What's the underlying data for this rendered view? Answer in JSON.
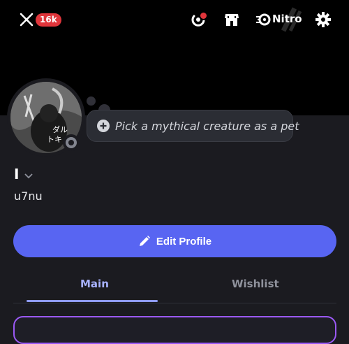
{
  "header": {
    "badge_count": "16k",
    "nitro_label": "Nitro",
    "colors": {
      "badge": "#e0353b",
      "accent": "#5865f2"
    }
  },
  "profile": {
    "status_text": "Pick a mythical creature as a pet",
    "display_name": "I",
    "username": "u7nu",
    "avatar_text": "ダルトキッド"
  },
  "actions": {
    "edit_profile_label": "Edit Profile"
  },
  "tabs": [
    {
      "label": "Main",
      "active": true
    },
    {
      "label": "Wishlist",
      "active": false
    }
  ],
  "icons": [
    "close-icon",
    "quests-icon",
    "shop-icon",
    "nitro-icon",
    "settings-icon",
    "plus-circle-icon",
    "chevron-down-icon",
    "pencil-icon"
  ]
}
